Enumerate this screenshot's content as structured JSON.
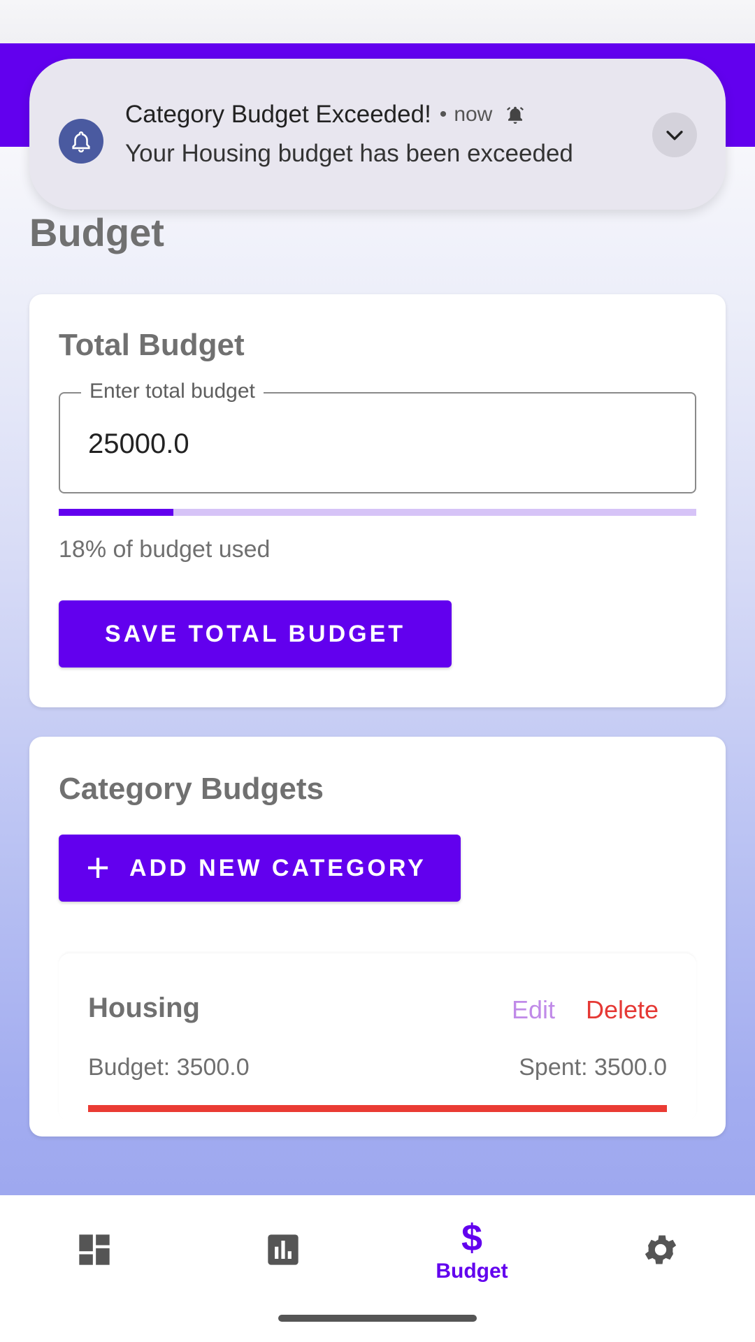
{
  "notification": {
    "title": "Category Budget Exceeded!",
    "time": "now",
    "body": "Your Housing budget has been exceeded",
    "icon": "bell-icon",
    "expand_icon": "chevron-down-icon"
  },
  "page": {
    "title": "Budget"
  },
  "total_budget": {
    "title": "Total Budget",
    "field_label": "Enter total budget",
    "field_value": "25000.0",
    "progress_fraction": 0.18,
    "used_text": "18% of budget used",
    "save_label": "SAVE TOTAL BUDGET"
  },
  "category_budgets": {
    "title": "Category Budgets",
    "add_label": "ADD NEW CATEGORY",
    "items": [
      {
        "name": "Housing",
        "edit_label": "Edit",
        "delete_label": "Delete",
        "budget_text": "Budget: 3500.0",
        "spent_text": "Spent: 3500.0",
        "progress_fraction": 1.0
      }
    ]
  },
  "bottom_nav": {
    "items": [
      {
        "icon": "dashboard-icon",
        "label": ""
      },
      {
        "icon": "bar-chart-icon",
        "label": ""
      },
      {
        "icon": "dollar-icon",
        "label": "Budget",
        "active": true
      },
      {
        "icon": "gear-icon",
        "label": ""
      }
    ],
    "active_color": "#6200ee"
  },
  "colors": {
    "primary": "#6200ee",
    "danger": "#e53935",
    "edit": "#c08ae8"
  }
}
